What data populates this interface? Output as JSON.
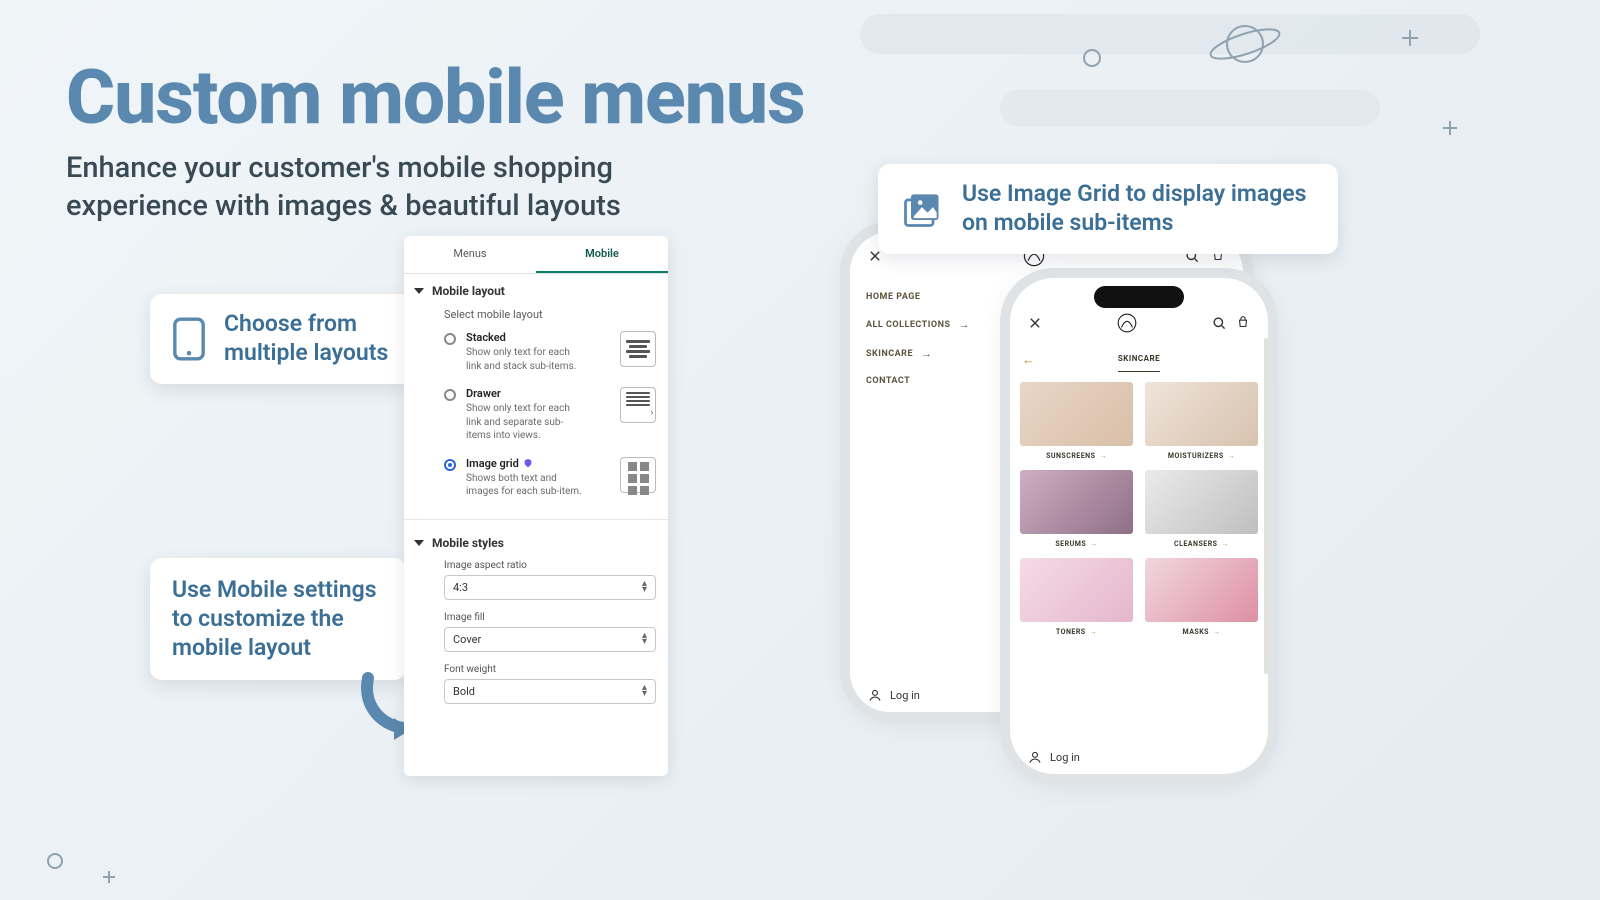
{
  "header": {
    "title": "Custom mobile menus",
    "subtitle": "Enhance your customer's mobile shopping experience with images & beautiful layouts"
  },
  "callouts": {
    "layouts": "Choose from multiple layouts",
    "settings": "Use Mobile settings to customize the mobile layout",
    "image_grid": "Use Image Grid to display images on mobile sub-items"
  },
  "panel": {
    "tabs": {
      "menus": "Menus",
      "mobile": "Mobile"
    },
    "layout": {
      "heading": "Mobile layout",
      "select_label": "Select mobile layout",
      "options": [
        {
          "title": "Stacked",
          "desc": "Show only text for each link and stack sub-items.",
          "selected": false
        },
        {
          "title": "Drawer",
          "desc": "Show only text for each link and separate sub-items into views.",
          "selected": false
        },
        {
          "title": "Image grid",
          "desc": "Shows both text and images for each sub-item.",
          "selected": true,
          "badge": true
        }
      ]
    },
    "styles": {
      "heading": "Mobile styles",
      "fields": [
        {
          "label": "Image aspect ratio",
          "value": "4:3"
        },
        {
          "label": "Image fill",
          "value": "Cover"
        },
        {
          "label": "Font weight",
          "value": "Bold"
        }
      ]
    }
  },
  "phone_drawer": {
    "items": [
      {
        "label": "HOME PAGE",
        "arrow": false
      },
      {
        "label": "ALL COLLECTIONS",
        "arrow": true
      },
      {
        "label": "SKINCARE",
        "arrow": true
      },
      {
        "label": "CONTACT",
        "arrow": false
      }
    ],
    "login": "Log in"
  },
  "phone_grid": {
    "heading": "SKINCARE",
    "login": "Log in",
    "cards": [
      {
        "label": "SUNSCREENS",
        "bg": "linear-gradient(135deg,#e9d6c7,#d8bfa8)"
      },
      {
        "label": "MOISTURIZERS",
        "bg": "linear-gradient(135deg,#f0e4da,#d7c2ae)"
      },
      {
        "label": "SERUMS",
        "bg": "linear-gradient(135deg,#cfaec2,#8d6f86)"
      },
      {
        "label": "CLEANSERS",
        "bg": "linear-gradient(135deg,#eaeaea,#bfbfbf)"
      },
      {
        "label": "TONERS",
        "bg": "linear-gradient(135deg,#f5dbe5,#e5b6cd)"
      },
      {
        "label": "MASKS",
        "bg": "linear-gradient(135deg,#f0d7de,#de8fa4)"
      }
    ]
  }
}
